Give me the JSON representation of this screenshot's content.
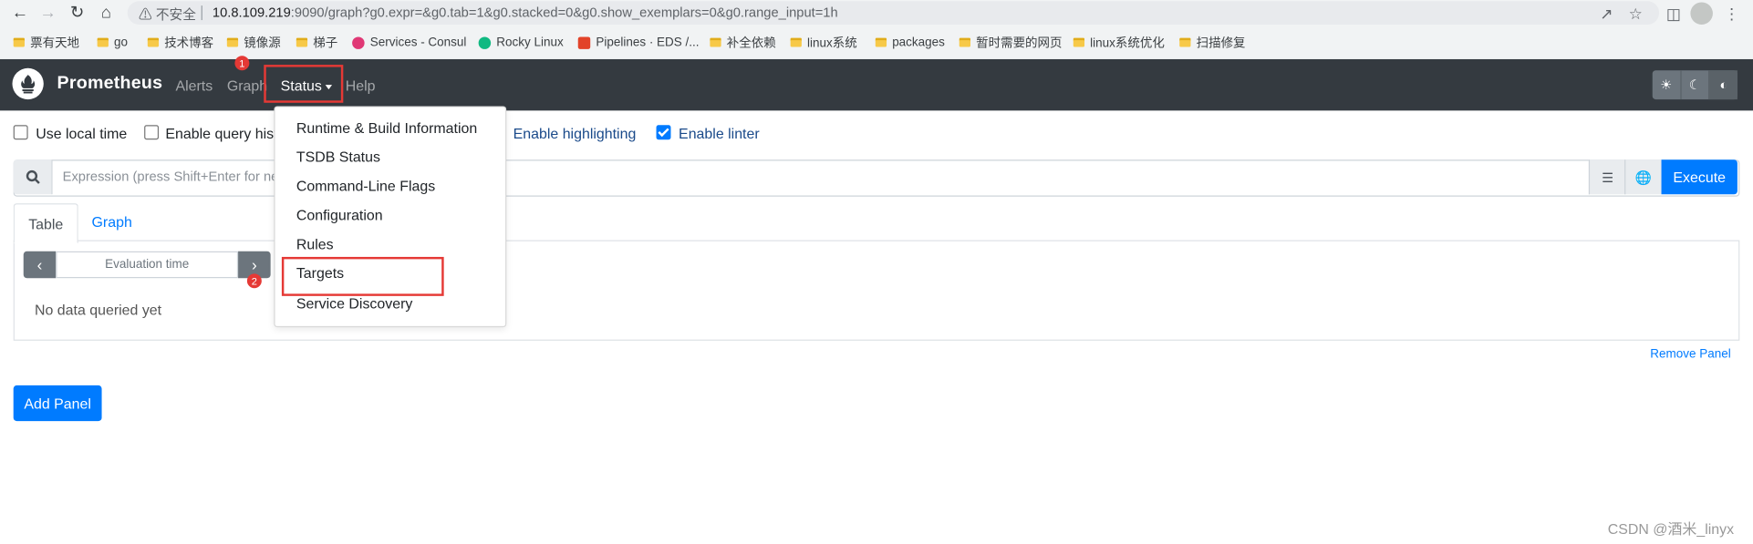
{
  "browser": {
    "insecure_label": "不安全",
    "url_host": "10.8.109.219",
    "url_rest": ":9090/graph?g0.expr=&g0.tab=1&g0.stacked=0&g0.show_exemplars=0&g0.range_input=1h",
    "bookmarks": [
      {
        "label": "票有天地",
        "icon": "folder-icon"
      },
      {
        "label": "go",
        "icon": "folder-icon"
      },
      {
        "label": "技术博客",
        "icon": "folder-icon"
      },
      {
        "label": "镜像源",
        "icon": "folder-icon"
      },
      {
        "label": "梯子",
        "icon": "folder-icon"
      },
      {
        "label": "Services - Consul",
        "icon": "consul-icon",
        "color": "#e03875"
      },
      {
        "label": "Rocky Linux",
        "icon": "rocky-icon",
        "color": "#10b981"
      },
      {
        "label": "Pipelines · EDS /...",
        "icon": "gitlab-icon",
        "color": "#e24329"
      },
      {
        "label": "补全依赖",
        "icon": "folder-icon"
      },
      {
        "label": "linux系统",
        "icon": "folder-icon"
      },
      {
        "label": "packages",
        "icon": "folder-icon"
      },
      {
        "label": "暂时需要的网页",
        "icon": "folder-icon"
      },
      {
        "label": "linux系统优化",
        "icon": "folder-icon"
      },
      {
        "label": "扫描修复",
        "icon": "folder-icon"
      }
    ]
  },
  "navbar": {
    "brand": "Prometheus",
    "alerts": "Alerts",
    "graph": "Graph",
    "status": "Status",
    "help": "Help"
  },
  "options": {
    "use_local_time": "Use local time",
    "enable_query_history": "Enable query hist",
    "enable_highlighting": "Enable highlighting",
    "enable_linter": "Enable linter"
  },
  "expression": {
    "placeholder": "Expression (press Shift+Enter for ne",
    "execute_label": "Execute"
  },
  "tabs": {
    "table": "Table",
    "graph": "Graph"
  },
  "panel": {
    "evaluation_time": "Evaluation time",
    "no_data": "No data queried yet",
    "remove_panel": "Remove Panel"
  },
  "add_panel": "Add Panel",
  "status_menu": [
    "Runtime & Build Information",
    "TSDB Status",
    "Command-Line Flags",
    "Configuration",
    "Rules",
    "Targets",
    "Service Discovery"
  ],
  "annotations": {
    "step1": "1",
    "step2": "2",
    "highlight_color": "#e53935"
  },
  "watermark": "CSDN @酒米_linyx"
}
